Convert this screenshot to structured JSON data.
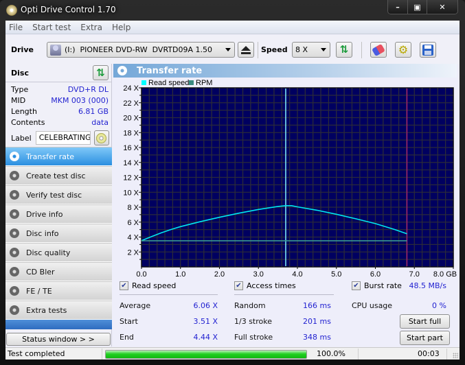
{
  "window": {
    "title": "Opti Drive Control 1.70",
    "controls": [
      "minimize",
      "maximize",
      "close"
    ]
  },
  "menu": {
    "items": [
      "File",
      "Start test",
      "Extra",
      "Help"
    ]
  },
  "toolbar": {
    "drive_label": "Drive",
    "drive_value": "(I:)  PIONEER DVD-RW  DVRTD09A 1.50",
    "speed_label": "Speed",
    "speed_value": "8 X",
    "icons": [
      "eject-icon",
      "refresh-icon",
      "erase-icon",
      "settings-icon",
      "save-icon"
    ]
  },
  "disc": {
    "title": "Disc",
    "rows": [
      {
        "label": "Type",
        "value": "DVD+R DL"
      },
      {
        "label": "MID",
        "value": "MKM 003 (000)"
      },
      {
        "label": "Length",
        "value": "6.81 GB"
      },
      {
        "label": "Contents",
        "value": "data"
      }
    ],
    "label_caption": "Label",
    "label_value": "CELEBRATING_"
  },
  "nav": {
    "items": [
      {
        "label": "Transfer rate",
        "active": true
      },
      {
        "label": "Create test disc",
        "active": false
      },
      {
        "label": "Verify test disc",
        "active": false
      },
      {
        "label": "Drive info",
        "active": false
      },
      {
        "label": "Disc info",
        "active": false
      },
      {
        "label": "Disc quality",
        "active": false
      },
      {
        "label": "CD Bler",
        "active": false
      },
      {
        "label": "FE / TE",
        "active": false
      },
      {
        "label": "Extra tests",
        "active": false
      }
    ],
    "status_window_label": "Status window > >"
  },
  "panel": {
    "title": "Transfer rate"
  },
  "chart_data": {
    "type": "line",
    "title": "Transfer rate",
    "legend": [
      {
        "name": "Read speed",
        "color": "#00ffff"
      },
      {
        "name": "RPM",
        "color": "#3a8a80"
      }
    ],
    "legend_position": "top-left",
    "xlabel": "GB",
    "ylabel": "X",
    "xlim": [
      0,
      8
    ],
    "ylim": [
      0,
      24
    ],
    "x_ticks": [
      "0.0",
      "1.0",
      "2.0",
      "3.0",
      "4.0",
      "5.0",
      "6.0",
      "7.0",
      "8.0 GB"
    ],
    "y_ticks": [
      "2 X",
      "4 X",
      "6 X",
      "8 X",
      "10 X",
      "12 X",
      "14 X",
      "16 X",
      "18 X",
      "20 X",
      "22 X",
      "24 X"
    ],
    "grid": true,
    "background": "#000060",
    "series": [
      {
        "name": "Read speed",
        "color": "#00e8f0",
        "x": [
          0.0,
          0.25,
          0.5,
          0.75,
          1.0,
          1.5,
          2.0,
          2.5,
          3.0,
          3.5,
          3.7,
          3.85,
          4.0,
          4.5,
          5.0,
          5.5,
          6.0,
          6.5,
          6.81
        ],
        "y": [
          3.51,
          4.05,
          4.55,
          5.0,
          5.4,
          6.05,
          6.65,
          7.2,
          7.7,
          8.1,
          8.2,
          8.2,
          8.05,
          7.6,
          7.05,
          6.45,
          5.8,
          5.0,
          4.44
        ]
      },
      {
        "name": "RPM",
        "color": "#3a9a90",
        "x": [
          0.0,
          6.81
        ],
        "y": [
          3.5,
          3.5
        ]
      }
    ],
    "markers": [
      {
        "name": "layer-break",
        "x": 3.7,
        "color": "#80f0ff"
      },
      {
        "name": "disc-end",
        "x": 6.81,
        "color": "#a02070"
      }
    ]
  },
  "stats": {
    "read_speed": {
      "label": "Read speed",
      "checked": true,
      "rows": [
        {
          "label": "Average",
          "value": "6.06 X"
        },
        {
          "label": "Start",
          "value": "3.51 X"
        },
        {
          "label": "End",
          "value": "4.44 X"
        }
      ]
    },
    "access_times": {
      "label": "Access times",
      "checked": true,
      "rows": [
        {
          "label": "Random",
          "value": "166 ms"
        },
        {
          "label": "1/3 stroke",
          "value": "201 ms"
        },
        {
          "label": "Full stroke",
          "value": "348 ms"
        }
      ]
    },
    "burst_rate": {
      "label": "Burst rate",
      "checked": true,
      "value": "48.5 MB/s"
    },
    "cpu_usage": {
      "label": "CPU usage",
      "value": "0 %"
    },
    "start_full_label": "Start full",
    "start_part_label": "Start part"
  },
  "statusbar": {
    "text": "Test completed",
    "progress": 1.0,
    "progress_text": "100.0%",
    "elapsed": "00:03"
  }
}
